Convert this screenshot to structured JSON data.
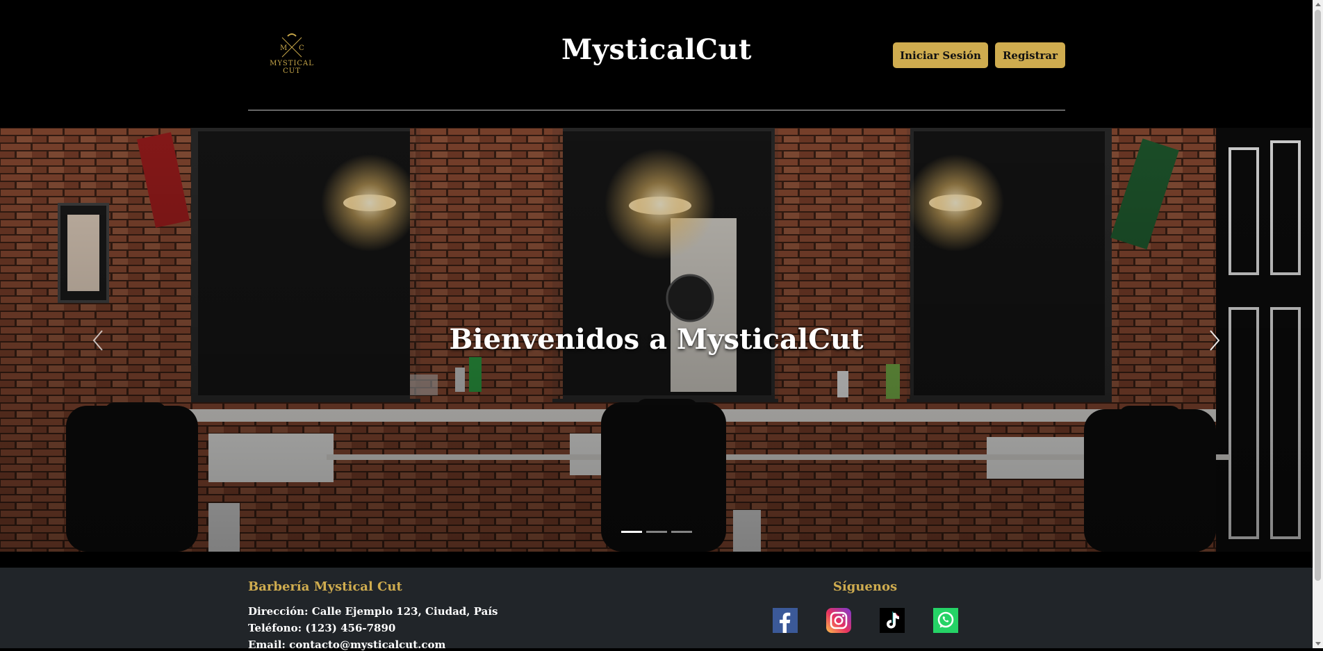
{
  "header": {
    "logo_text_1": "MYSTICAL",
    "logo_text_2": "CUT",
    "logo_monogram_left": "M",
    "logo_monogram_right": "C",
    "site_title": "MysticalCut",
    "login_label": "Iniciar Sesión",
    "register_label": "Registrar"
  },
  "hero": {
    "caption": "Bienvenidos a MysticalCut",
    "active_slide": 1,
    "slide_count": 3
  },
  "footer": {
    "business_title": "Barbería Mystical Cut",
    "address": "Dirección: Calle Ejemplo 123, Ciudad, País",
    "phone": "Teléfono: (123) 456-7890",
    "email": "Email: contacto@mysticalcut.com",
    "follow_title": "Síguenos",
    "social_icons": [
      "facebook-icon",
      "instagram-icon",
      "tiktok-icon",
      "whatsapp-icon"
    ]
  },
  "colors": {
    "accent": "#cfac4f",
    "background": "#000000",
    "footer_bg": "#212529"
  }
}
